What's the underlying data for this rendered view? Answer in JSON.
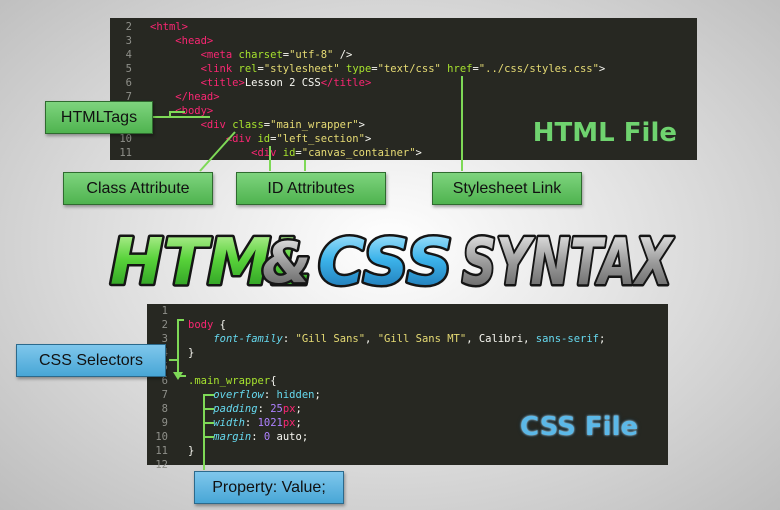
{
  "html_file": {
    "label": "HTML File",
    "lines": [
      {
        "n": "2",
        "tokens": [
          [
            "tag",
            "<html>"
          ]
        ]
      },
      {
        "n": "3",
        "tokens": [
          [
            "txt",
            "    "
          ],
          [
            "tag",
            "<head>"
          ]
        ]
      },
      {
        "n": "4",
        "tokens": [
          [
            "txt",
            "        "
          ],
          [
            "tag",
            "<meta "
          ],
          [
            "attr",
            "charset"
          ],
          [
            "txt",
            "="
          ],
          [
            "str",
            "\"utf-8\""
          ],
          [
            "txt",
            " />"
          ]
        ]
      },
      {
        "n": "5",
        "tokens": [
          [
            "txt",
            "        "
          ],
          [
            "tag",
            "<link "
          ],
          [
            "attr",
            "rel"
          ],
          [
            "txt",
            "="
          ],
          [
            "str",
            "\"stylesheet\""
          ],
          [
            "txt",
            " "
          ],
          [
            "attr",
            "type"
          ],
          [
            "txt",
            "="
          ],
          [
            "str",
            "\"text/css\""
          ],
          [
            "txt",
            " "
          ],
          [
            "attr",
            "href"
          ],
          [
            "txt",
            "="
          ],
          [
            "str",
            "\"../css/styles.css\""
          ],
          [
            "txt",
            ">"
          ]
        ]
      },
      {
        "n": "6",
        "tokens": [
          [
            "txt",
            "        "
          ],
          [
            "tag",
            "<title>"
          ],
          [
            "txt",
            "Lesson 2 CSS"
          ],
          [
            "tag",
            "</title>"
          ]
        ]
      },
      {
        "n": "7",
        "tokens": [
          [
            "txt",
            "    "
          ],
          [
            "tag",
            "</head>"
          ]
        ]
      },
      {
        "n": "8",
        "tokens": [
          [
            "txt",
            "    "
          ],
          [
            "tag",
            "<body>"
          ]
        ]
      },
      {
        "n": "9",
        "tokens": [
          [
            "txt",
            "        "
          ],
          [
            "tag",
            "<div "
          ],
          [
            "attr",
            "class"
          ],
          [
            "txt",
            "="
          ],
          [
            "str",
            "\"main_wrapper\""
          ],
          [
            "txt",
            ">"
          ]
        ]
      },
      {
        "n": "10",
        "tokens": [
          [
            "txt",
            "            "
          ],
          [
            "tag",
            "<div "
          ],
          [
            "attr",
            "id"
          ],
          [
            "txt",
            "="
          ],
          [
            "str",
            "\"left_section\""
          ],
          [
            "txt",
            ">"
          ]
        ]
      },
      {
        "n": "11",
        "tokens": [
          [
            "txt",
            "                "
          ],
          [
            "tag",
            "<div "
          ],
          [
            "attr",
            "id"
          ],
          [
            "txt",
            "="
          ],
          [
            "str",
            "\"canvas_container\""
          ],
          [
            "txt",
            ">"
          ]
        ]
      }
    ]
  },
  "css_file": {
    "label": "CSS File",
    "lines": [
      {
        "n": "1",
        "tokens": []
      },
      {
        "n": "2",
        "tokens": [
          [
            "tag",
            "body"
          ],
          [
            "txt",
            " {"
          ]
        ]
      },
      {
        "n": "3",
        "tokens": [
          [
            "txt",
            "    "
          ],
          [
            "prop",
            "font-family"
          ],
          [
            "txt",
            ": "
          ],
          [
            "str",
            "\"Gill Sans\""
          ],
          [
            "txt",
            ", "
          ],
          [
            "str",
            "\"Gill Sans MT\""
          ],
          [
            "txt",
            ", Calibri, "
          ],
          [
            "val",
            "sans-serif"
          ],
          [
            "txt",
            ";"
          ]
        ]
      },
      {
        "n": "4",
        "tokens": [
          [
            "txt",
            "}"
          ]
        ]
      },
      {
        "n": "5",
        "tokens": []
      },
      {
        "n": "6",
        "tokens": [
          [
            "sel",
            ".main_wrapper"
          ],
          [
            "txt",
            "{"
          ]
        ]
      },
      {
        "n": "7",
        "tokens": [
          [
            "txt",
            "    "
          ],
          [
            "prop",
            "overflow"
          ],
          [
            "txt",
            ": "
          ],
          [
            "val",
            "hidden"
          ],
          [
            "txt",
            ";"
          ]
        ]
      },
      {
        "n": "8",
        "tokens": [
          [
            "txt",
            "    "
          ],
          [
            "prop",
            "padding"
          ],
          [
            "txt",
            ": "
          ],
          [
            "num",
            "25"
          ],
          [
            "tag",
            "px"
          ],
          [
            "txt",
            ";"
          ]
        ]
      },
      {
        "n": "9",
        "tokens": [
          [
            "txt",
            "    "
          ],
          [
            "prop",
            "width"
          ],
          [
            "txt",
            ": "
          ],
          [
            "num",
            "1021"
          ],
          [
            "tag",
            "px"
          ],
          [
            "txt",
            ";"
          ]
        ]
      },
      {
        "n": "10",
        "tokens": [
          [
            "txt",
            "    "
          ],
          [
            "prop",
            "margin"
          ],
          [
            "txt",
            ": "
          ],
          [
            "num",
            "0"
          ],
          [
            "txt",
            " auto;"
          ]
        ]
      },
      {
        "n": "11",
        "tokens": [
          [
            "txt",
            "}"
          ]
        ]
      },
      {
        "n": "12",
        "tokens": []
      }
    ]
  },
  "callouts": {
    "html_tags": "HTMLTags",
    "class_attribute": "Class Attribute",
    "id_attributes": "ID Attributes",
    "stylesheet_link": "Stylesheet Link",
    "css_selectors": "CSS Selectors",
    "property_value": "Property: Value;"
  },
  "banner": {
    "word1": "HTML",
    "amp": "&",
    "word2": "CSS",
    "word3": "SYNTAX"
  },
  "colors": {
    "code_bg": "#272822",
    "callout_green": "#5cbf5c",
    "callout_blue": "#5ab4e2",
    "connector": "#7ed957"
  }
}
